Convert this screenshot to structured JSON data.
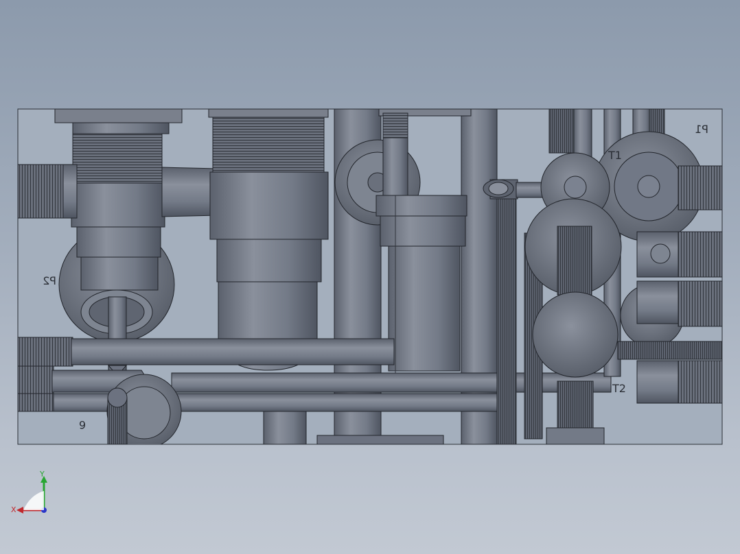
{
  "viewport": {
    "background_top": "#8c9aac",
    "background_bottom": "#c2c9d3",
    "part_color": "#6f7684",
    "edge_color": "#22252b"
  },
  "labels": {
    "p1": "P1",
    "p2": "P2",
    "t1": "T1",
    "t2": "T2",
    "nine": "6"
  },
  "triad": {
    "x_label": "X",
    "y_label": "Y",
    "x_color": "#c0282d",
    "y_color": "#28a632",
    "z_color": "#2a36c8"
  }
}
